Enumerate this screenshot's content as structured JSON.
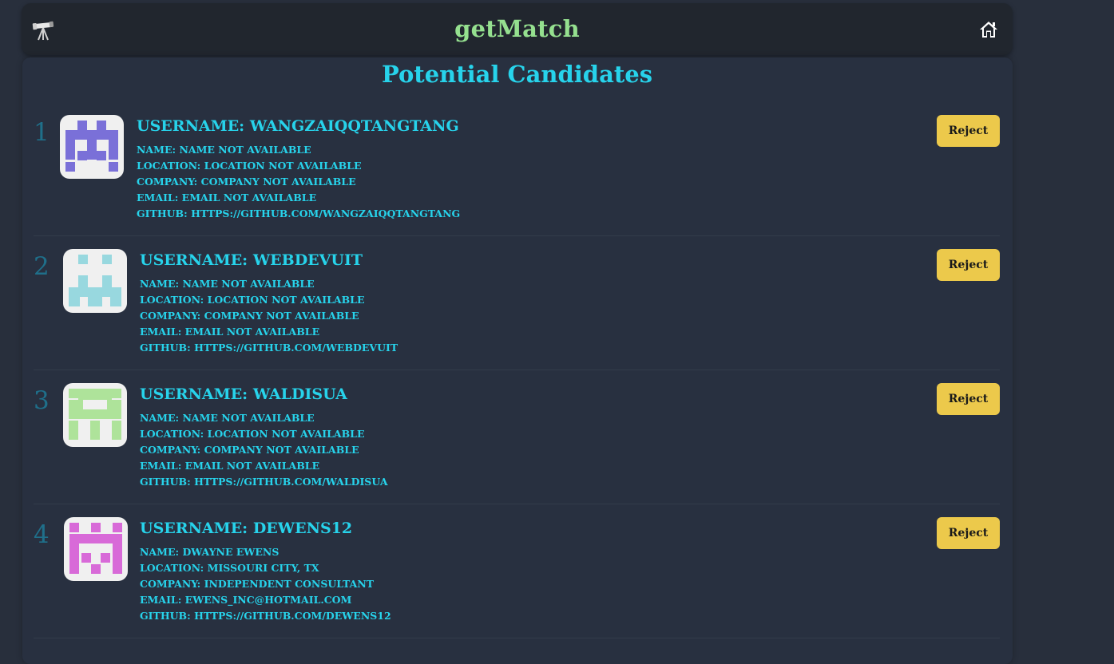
{
  "nav": {
    "title": "getMatch",
    "logo_icon": "telescope-icon",
    "home_icon": "home-icon"
  },
  "page": {
    "title": "Potential Candidates"
  },
  "colors": {
    "accent": "#27d3eb",
    "brand": "#95e08f",
    "button": "#ecc94b",
    "rank": "#1f6f8a"
  },
  "candidates": [
    {
      "rank": "1",
      "username": "USERNAME: WANGZAIQQTANGTANG",
      "name": "NAME: NAME NOT AVAILABLE",
      "location": "LOCATION: LOCATION NOT AVAILABLE",
      "company": "COMPANY: COMPANY NOT AVAILABLE",
      "email": "EMAIL: EMAIL NOT AVAILABLE",
      "github": "GITHUB: HTTPS://GITHUB.COM/WANGZAIQQTANGTANG",
      "reject_label": "Reject",
      "avatar_color": "#7a70d8"
    },
    {
      "rank": "2",
      "username": "USERNAME: WEBDEVUIT",
      "name": "NAME: NAME NOT AVAILABLE",
      "location": "LOCATION: LOCATION NOT AVAILABLE",
      "company": "COMPANY: COMPANY NOT AVAILABLE",
      "email": "EMAIL: EMAIL NOT AVAILABLE",
      "github": "GITHUB: HTTPS://GITHUB.COM/WEBDEVUIT",
      "reject_label": "Reject",
      "avatar_color": "#98d8df"
    },
    {
      "rank": "3",
      "username": "USERNAME: WALDISUA",
      "name": "NAME: NAME NOT AVAILABLE",
      "location": "LOCATION: LOCATION NOT AVAILABLE",
      "company": "COMPANY: COMPANY NOT AVAILABLE",
      "email": "EMAIL: EMAIL NOT AVAILABLE",
      "github": "GITHUB: HTTPS://GITHUB.COM/WALDISUA",
      "reject_label": "Reject",
      "avatar_color": "#aee39a"
    },
    {
      "rank": "4",
      "username": "USERNAME: DEWENS12",
      "name": "NAME: DWAYNE EWENS",
      "location": "LOCATION: MISSOURI CITY, TX",
      "company": "COMPANY: INDEPENDENT CONSULTANT",
      "email": "EMAIL: EWENS_INC@HOTMAIL.COM",
      "github": "GITHUB: HTTPS://GITHUB.COM/DEWENS12",
      "reject_label": "Reject",
      "avatar_color": "#d86ad8"
    }
  ]
}
